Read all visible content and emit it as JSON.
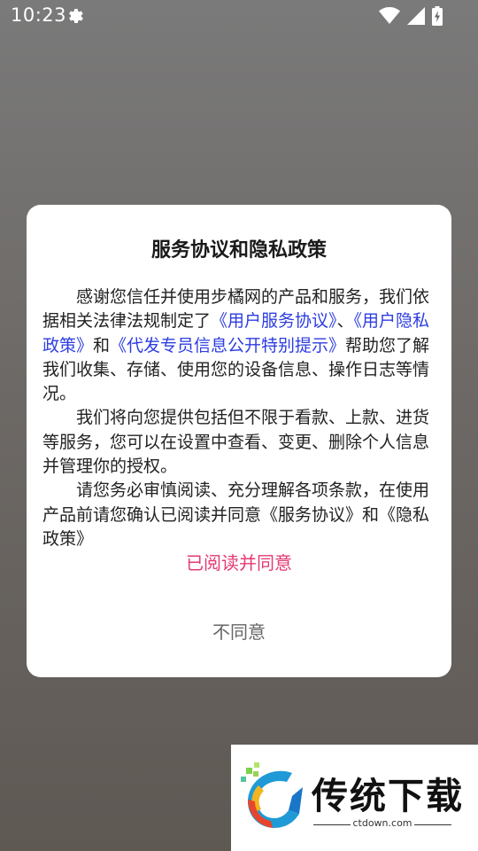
{
  "status_bar": {
    "time": "10:23",
    "icons": [
      "gear-icon",
      "wifi-icon",
      "signal-icon",
      "battery-charging-icon"
    ]
  },
  "dialog": {
    "title": "服务协议和隐私政策",
    "paragraph1": {
      "text_before": "感谢您信任并使用步橘网的产品和服务，我们依据相关法律法规制定了",
      "link_service": "《用户服务协议》",
      "separator": "、",
      "link_privacy": "《用户隐私政策》",
      "conjunction": "和",
      "link_special": "《代发专员信息公开特别提示》",
      "text_after": "帮助您了解我们收集、存储、使用您的设备信息、操作日志等情况。"
    },
    "paragraph2": "我们将向您提供包括但不限于看款、上款、进货等服务，您可以在设置中查看、变更、删除个人信息并管理你的授权。",
    "paragraph3": "请您务必审慎阅读、充分理解各项条款，在使用产品前请您确认已阅读并同意《服务协议》和《隐私政策》",
    "agree_label": "已阅读并同意",
    "disagree_label": "不同意"
  },
  "watermark": {
    "brand": "传统下载",
    "url": "ctdown.com"
  },
  "colors": {
    "link": "#2d3de0",
    "agree": "#e33a72",
    "disagree": "#666666"
  }
}
